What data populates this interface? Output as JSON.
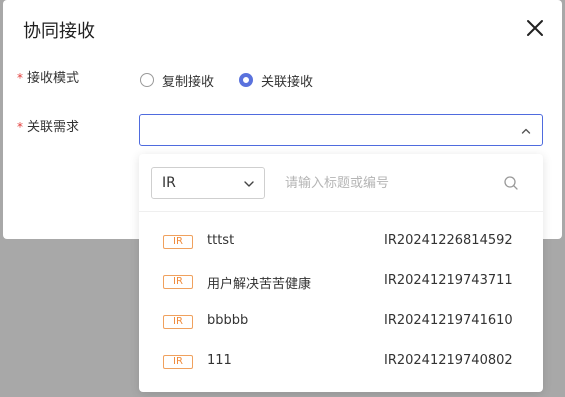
{
  "dialog": {
    "title": "协同接收",
    "mode_label": "接收模式",
    "mode_options": [
      "复制接收",
      "关联接收"
    ],
    "mode_selected": "关联接收",
    "demand_label": "关联需求",
    "required_mark": "*"
  },
  "dropdown": {
    "type_value": "IR",
    "search_placeholder": "请输入标题或编号",
    "items": [
      {
        "badge": "IR",
        "name": "tttst",
        "code": "IR20241226814592"
      },
      {
        "badge": "IR",
        "name": "用户解决苦苦健康",
        "code": "IR20241219743711"
      },
      {
        "badge": "IR",
        "name": "bbbbb",
        "code": "IR20241219741610"
      },
      {
        "badge": "IR",
        "name": "111",
        "code": "IR20241219740802"
      }
    ]
  },
  "colors": {
    "accent": "#5a72dd",
    "required": "#e23c39",
    "badge": "#f08a3a"
  }
}
